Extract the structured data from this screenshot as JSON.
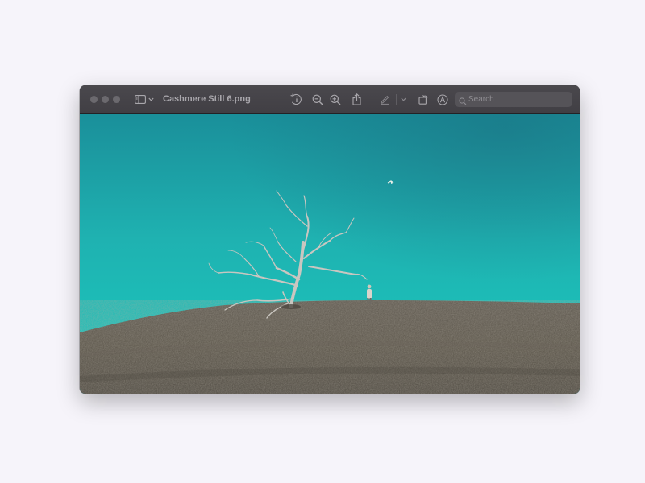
{
  "window": {
    "title": "Cashmere Still 6.png"
  },
  "toolbar": {
    "icons": [
      "sidebar-toggle-icon",
      "chevron-down-icon",
      "info-icon",
      "zoom-out-icon",
      "zoom-in-icon",
      "share-icon",
      "markup-pen-icon",
      "chevron-down-icon",
      "rotate-icon",
      "annotate-icon"
    ],
    "search_placeholder": "Search"
  },
  "image": {
    "subject": "dead tree and person on grassy hill under teal sky",
    "sky_colors": [
      "#1a8f9a",
      "#1fb8b4",
      "#18c8bd"
    ],
    "hill_color": "#5e574e"
  }
}
